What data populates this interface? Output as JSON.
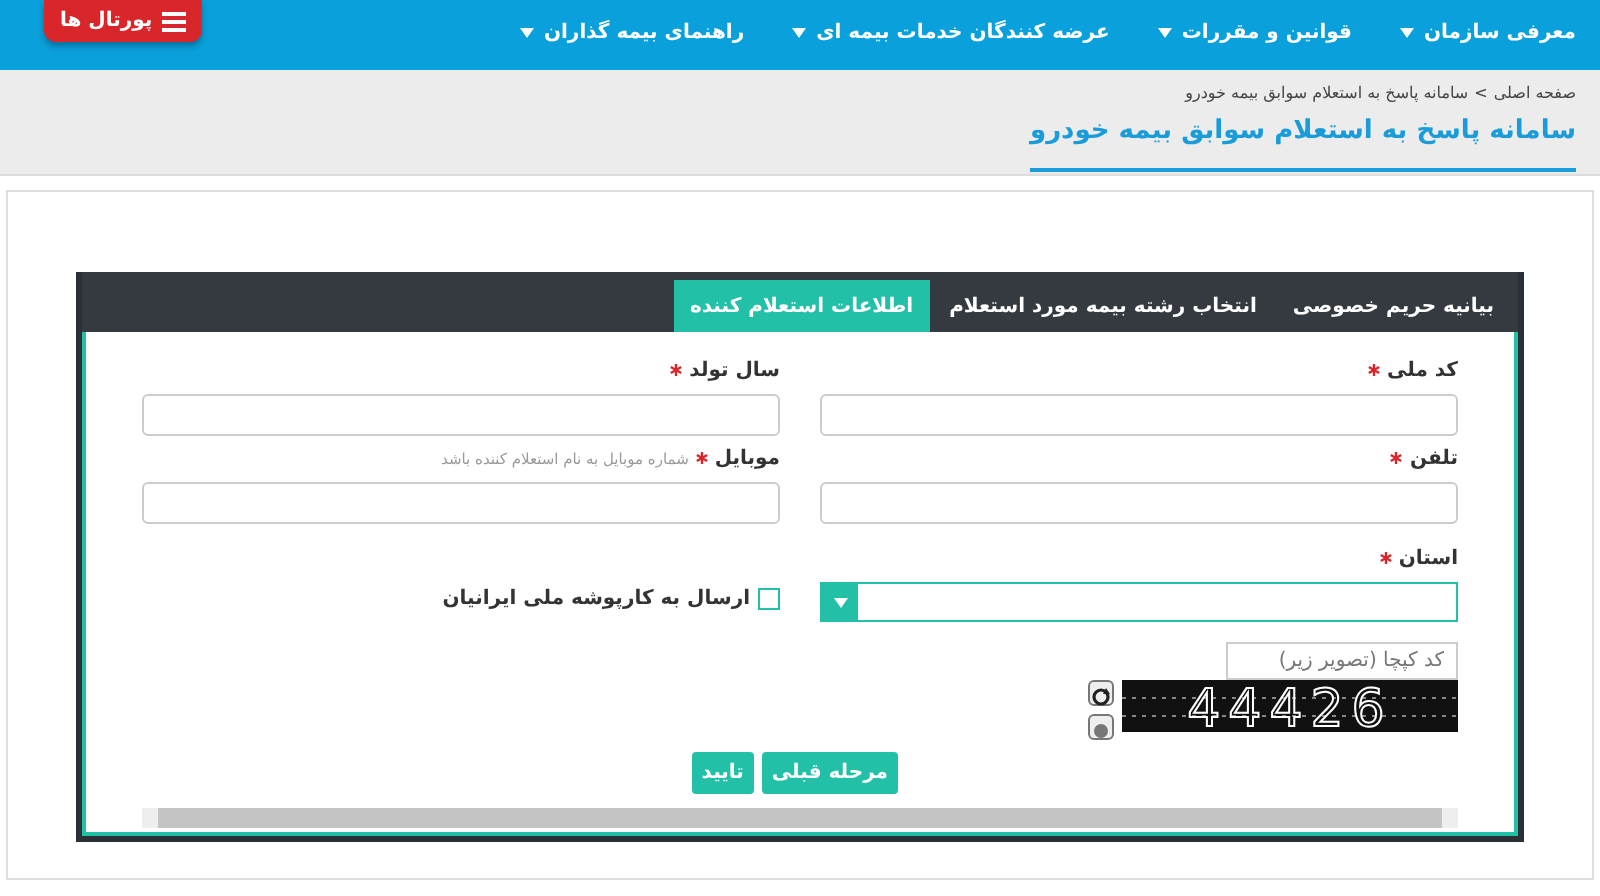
{
  "portal_button": {
    "label": "پورتال ها"
  },
  "nav": [
    {
      "label": "معرفی سازمان"
    },
    {
      "label": "قوانین و مقررات"
    },
    {
      "label": "عرضه کنندگان خدمات بیمه ای"
    },
    {
      "label": "راهنمای بیمه گذاران"
    }
  ],
  "breadcrumb": [
    {
      "label": "صفحه اصلی"
    },
    {
      "label": "سامانه پاسخ به استعلام سوابق بیمه خودرو"
    }
  ],
  "breadcrumb_separator": ">",
  "page_title": "سامانه پاسخ به استعلام سوابق بیمه خودرو",
  "tabs": [
    {
      "label": "بیانیه حریم خصوصی",
      "selected": false
    },
    {
      "label": "انتخاب رشته بیمه مورد استعلام",
      "selected": false
    },
    {
      "label": "اطلاعات استعلام کننده",
      "selected": true
    }
  ],
  "fields": [
    {
      "label": "کد ملی",
      "required": true
    },
    {
      "label": "سال تولد",
      "required": true
    },
    {
      "label": "تلفن",
      "required": true
    },
    {
      "label": "موبایل",
      "required": true,
      "hint": "شماره موبایل به نام استعلام کننده باشد"
    }
  ],
  "province": {
    "label": "استان",
    "required": true
  },
  "send_checkbox": {
    "label": "ارسال به کارپوشه ملی ایرانیان",
    "checked": false
  },
  "captcha": {
    "placeholder": "کد کپچا (تصویر زیر)",
    "code": "44426"
  },
  "buttons": [
    {
      "label": "مرحله قبلی"
    },
    {
      "label": "تایید"
    }
  ]
}
